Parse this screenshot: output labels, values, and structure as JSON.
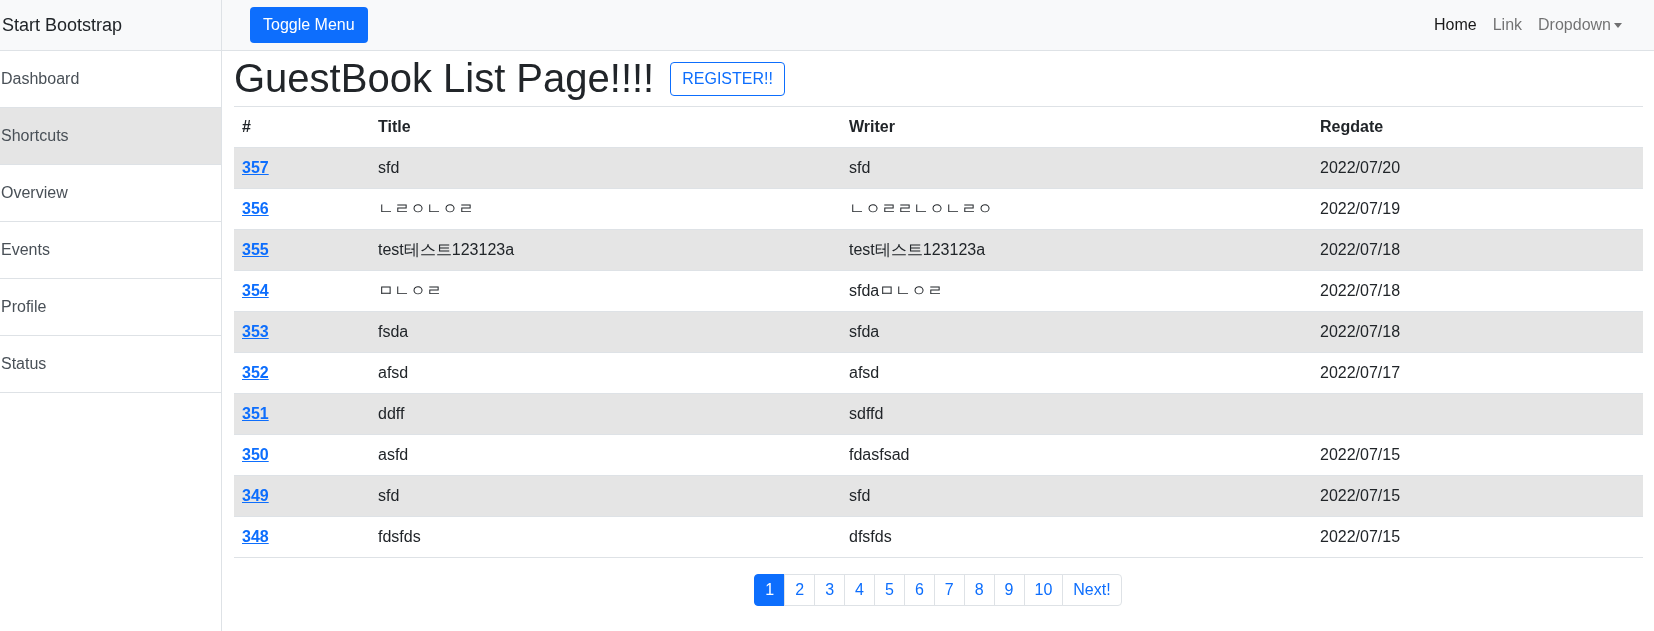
{
  "sidebar": {
    "brand": "Start Bootstrap",
    "items": [
      {
        "label": "Dashboard",
        "selected": false
      },
      {
        "label": "Shortcuts",
        "selected": true
      },
      {
        "label": "Overview",
        "selected": false
      },
      {
        "label": "Events",
        "selected": false
      },
      {
        "label": "Profile",
        "selected": false
      },
      {
        "label": "Status",
        "selected": false
      }
    ]
  },
  "navbar": {
    "toggle_button": "Toggle Menu",
    "links": [
      {
        "label": "Home",
        "selected": true,
        "kind": "link"
      },
      {
        "label": "Link",
        "selected": false,
        "kind": "link"
      },
      {
        "label": "Dropdown",
        "selected": false,
        "kind": "dropdown"
      }
    ]
  },
  "page": {
    "title": "GuestBook List Page!!!!",
    "register_button": "REGISTER!!"
  },
  "table": {
    "columns": [
      "#",
      "Title",
      "Writer",
      "Regdate"
    ],
    "rows": [
      [
        "357",
        "sfd",
        "sfd",
        "2022/07/20"
      ],
      [
        "356",
        "ㄴㄹㅇㄴㅇㄹ",
        "ㄴㅇㄹㄹㄴㅇㄴㄹㅇ",
        "2022/07/19"
      ],
      [
        "355",
        "test테스트123123a",
        "test테스트123123a",
        "2022/07/18"
      ],
      [
        "354",
        "ㅁㄴㅇㄹ",
        "sfdaㅁㄴㅇㄹ",
        "2022/07/18"
      ],
      [
        "353",
        "fsda",
        "sfda",
        "2022/07/18"
      ],
      [
        "352",
        "afsd",
        "afsd",
        "2022/07/17"
      ],
      [
        "351",
        "ddff",
        "sdffd",
        ""
      ],
      [
        "350",
        "asfd",
        "fdasfsad",
        "2022/07/15"
      ],
      [
        "349",
        "sfd",
        "sfd",
        "2022/07/15"
      ],
      [
        "348",
        "fdsfds",
        "dfsfds",
        "2022/07/15"
      ]
    ]
  },
  "pagination": [
    {
      "label": "1",
      "selected": true
    },
    {
      "label": "2",
      "selected": false
    },
    {
      "label": "3",
      "selected": false
    },
    {
      "label": "4",
      "selected": false
    },
    {
      "label": "5",
      "selected": false
    },
    {
      "label": "6",
      "selected": false
    },
    {
      "label": "7",
      "selected": false
    },
    {
      "label": "8",
      "selected": false
    },
    {
      "label": "9",
      "selected": false
    },
    {
      "label": "10",
      "selected": false
    },
    {
      "label": "Next!",
      "selected": false
    }
  ]
}
